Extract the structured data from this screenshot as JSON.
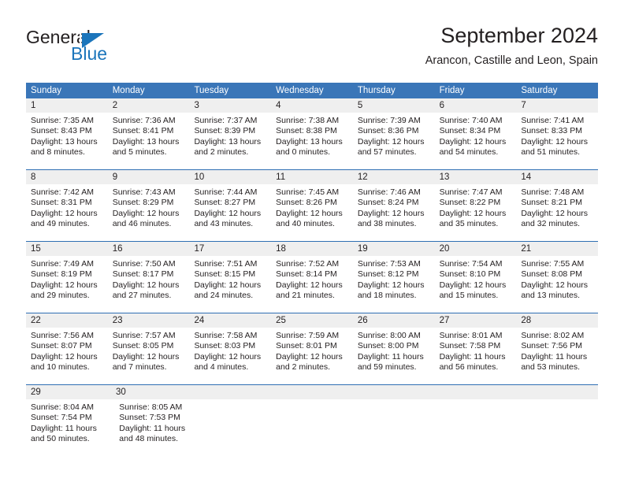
{
  "logo": {
    "word_general": "General",
    "word_blue": "Blue",
    "accent_color": "#1b75bb"
  },
  "header": {
    "title": "September 2024",
    "subtitle": "Arancon, Castille and Leon, Spain"
  },
  "calendar": {
    "header_bg": "#3a76b8",
    "daynum_bg": "#efefef",
    "row_divider_color": "#2f6fb3",
    "weekdays": [
      "Sunday",
      "Monday",
      "Tuesday",
      "Wednesday",
      "Thursday",
      "Friday",
      "Saturday"
    ],
    "weeks": [
      {
        "lead_blanks": 0,
        "days": [
          {
            "num": "1",
            "sunrise": "Sunrise: 7:35 AM",
            "sunset": "Sunset: 8:43 PM",
            "daylight1": "Daylight: 13 hours",
            "daylight2": "and 8 minutes."
          },
          {
            "num": "2",
            "sunrise": "Sunrise: 7:36 AM",
            "sunset": "Sunset: 8:41 PM",
            "daylight1": "Daylight: 13 hours",
            "daylight2": "and 5 minutes."
          },
          {
            "num": "3",
            "sunrise": "Sunrise: 7:37 AM",
            "sunset": "Sunset: 8:39 PM",
            "daylight1": "Daylight: 13 hours",
            "daylight2": "and 2 minutes."
          },
          {
            "num": "4",
            "sunrise": "Sunrise: 7:38 AM",
            "sunset": "Sunset: 8:38 PM",
            "daylight1": "Daylight: 13 hours",
            "daylight2": "and 0 minutes."
          },
          {
            "num": "5",
            "sunrise": "Sunrise: 7:39 AM",
            "sunset": "Sunset: 8:36 PM",
            "daylight1": "Daylight: 12 hours",
            "daylight2": "and 57 minutes."
          },
          {
            "num": "6",
            "sunrise": "Sunrise: 7:40 AM",
            "sunset": "Sunset: 8:34 PM",
            "daylight1": "Daylight: 12 hours",
            "daylight2": "and 54 minutes."
          },
          {
            "num": "7",
            "sunrise": "Sunrise: 7:41 AM",
            "sunset": "Sunset: 8:33 PM",
            "daylight1": "Daylight: 12 hours",
            "daylight2": "and 51 minutes."
          }
        ]
      },
      {
        "lead_blanks": 0,
        "days": [
          {
            "num": "8",
            "sunrise": "Sunrise: 7:42 AM",
            "sunset": "Sunset: 8:31 PM",
            "daylight1": "Daylight: 12 hours",
            "daylight2": "and 49 minutes."
          },
          {
            "num": "9",
            "sunrise": "Sunrise: 7:43 AM",
            "sunset": "Sunset: 8:29 PM",
            "daylight1": "Daylight: 12 hours",
            "daylight2": "and 46 minutes."
          },
          {
            "num": "10",
            "sunrise": "Sunrise: 7:44 AM",
            "sunset": "Sunset: 8:27 PM",
            "daylight1": "Daylight: 12 hours",
            "daylight2": "and 43 minutes."
          },
          {
            "num": "11",
            "sunrise": "Sunrise: 7:45 AM",
            "sunset": "Sunset: 8:26 PM",
            "daylight1": "Daylight: 12 hours",
            "daylight2": "and 40 minutes."
          },
          {
            "num": "12",
            "sunrise": "Sunrise: 7:46 AM",
            "sunset": "Sunset: 8:24 PM",
            "daylight1": "Daylight: 12 hours",
            "daylight2": "and 38 minutes."
          },
          {
            "num": "13",
            "sunrise": "Sunrise: 7:47 AM",
            "sunset": "Sunset: 8:22 PM",
            "daylight1": "Daylight: 12 hours",
            "daylight2": "and 35 minutes."
          },
          {
            "num": "14",
            "sunrise": "Sunrise: 7:48 AM",
            "sunset": "Sunset: 8:21 PM",
            "daylight1": "Daylight: 12 hours",
            "daylight2": "and 32 minutes."
          }
        ]
      },
      {
        "lead_blanks": 0,
        "days": [
          {
            "num": "15",
            "sunrise": "Sunrise: 7:49 AM",
            "sunset": "Sunset: 8:19 PM",
            "daylight1": "Daylight: 12 hours",
            "daylight2": "and 29 minutes."
          },
          {
            "num": "16",
            "sunrise": "Sunrise: 7:50 AM",
            "sunset": "Sunset: 8:17 PM",
            "daylight1": "Daylight: 12 hours",
            "daylight2": "and 27 minutes."
          },
          {
            "num": "17",
            "sunrise": "Sunrise: 7:51 AM",
            "sunset": "Sunset: 8:15 PM",
            "daylight1": "Daylight: 12 hours",
            "daylight2": "and 24 minutes."
          },
          {
            "num": "18",
            "sunrise": "Sunrise: 7:52 AM",
            "sunset": "Sunset: 8:14 PM",
            "daylight1": "Daylight: 12 hours",
            "daylight2": "and 21 minutes."
          },
          {
            "num": "19",
            "sunrise": "Sunrise: 7:53 AM",
            "sunset": "Sunset: 8:12 PM",
            "daylight1": "Daylight: 12 hours",
            "daylight2": "and 18 minutes."
          },
          {
            "num": "20",
            "sunrise": "Sunrise: 7:54 AM",
            "sunset": "Sunset: 8:10 PM",
            "daylight1": "Daylight: 12 hours",
            "daylight2": "and 15 minutes."
          },
          {
            "num": "21",
            "sunrise": "Sunrise: 7:55 AM",
            "sunset": "Sunset: 8:08 PM",
            "daylight1": "Daylight: 12 hours",
            "daylight2": "and 13 minutes."
          }
        ]
      },
      {
        "lead_blanks": 0,
        "days": [
          {
            "num": "22",
            "sunrise": "Sunrise: 7:56 AM",
            "sunset": "Sunset: 8:07 PM",
            "daylight1": "Daylight: 12 hours",
            "daylight2": "and 10 minutes."
          },
          {
            "num": "23",
            "sunrise": "Sunrise: 7:57 AM",
            "sunset": "Sunset: 8:05 PM",
            "daylight1": "Daylight: 12 hours",
            "daylight2": "and 7 minutes."
          },
          {
            "num": "24",
            "sunrise": "Sunrise: 7:58 AM",
            "sunset": "Sunset: 8:03 PM",
            "daylight1": "Daylight: 12 hours",
            "daylight2": "and 4 minutes."
          },
          {
            "num": "25",
            "sunrise": "Sunrise: 7:59 AM",
            "sunset": "Sunset: 8:01 PM",
            "daylight1": "Daylight: 12 hours",
            "daylight2": "and 2 minutes."
          },
          {
            "num": "26",
            "sunrise": "Sunrise: 8:00 AM",
            "sunset": "Sunset: 8:00 PM",
            "daylight1": "Daylight: 11 hours",
            "daylight2": "and 59 minutes."
          },
          {
            "num": "27",
            "sunrise": "Sunrise: 8:01 AM",
            "sunset": "Sunset: 7:58 PM",
            "daylight1": "Daylight: 11 hours",
            "daylight2": "and 56 minutes."
          },
          {
            "num": "28",
            "sunrise": "Sunrise: 8:02 AM",
            "sunset": "Sunset: 7:56 PM",
            "daylight1": "Daylight: 11 hours",
            "daylight2": "and 53 minutes."
          }
        ]
      },
      {
        "lead_blanks": 0,
        "days": [
          {
            "num": "29",
            "sunrise": "Sunrise: 8:04 AM",
            "sunset": "Sunset: 7:54 PM",
            "daylight1": "Daylight: 11 hours",
            "daylight2": "and 50 minutes."
          },
          {
            "num": "30",
            "sunrise": "Sunrise: 8:05 AM",
            "sunset": "Sunset: 7:53 PM",
            "daylight1": "Daylight: 11 hours",
            "daylight2": "and 48 minutes."
          }
        ]
      }
    ]
  }
}
